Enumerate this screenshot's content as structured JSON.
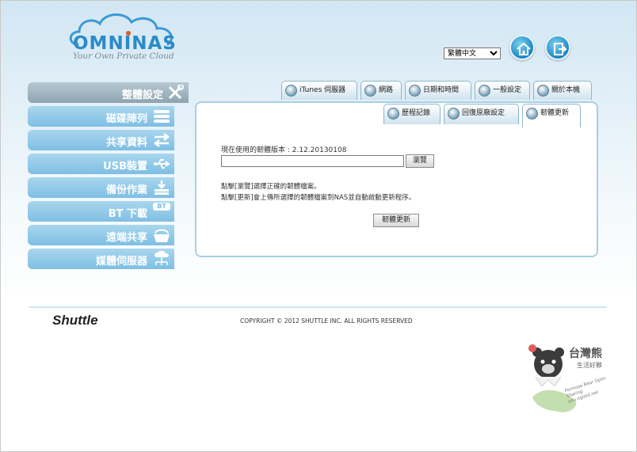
{
  "brand": {
    "name": "OMNINAS",
    "tagline": "Your Own Private Cloud"
  },
  "language": {
    "selected": "繁體中文"
  },
  "header_icons": {
    "home": "home-icon",
    "logout": "logout-icon"
  },
  "sidebar": {
    "items": [
      {
        "label": "整體設定",
        "icon": "tools-icon",
        "active": true
      },
      {
        "label": "磁碟陣列",
        "icon": "disk-stack-icon"
      },
      {
        "label": "共享資料",
        "icon": "share-arrows-icon"
      },
      {
        "label": "USB裝置",
        "icon": "usb-icon"
      },
      {
        "label": "備份作業",
        "icon": "backup-download-icon"
      },
      {
        "label": "BT 下載",
        "icon": "bt-download-icon",
        "badge": "BT"
      },
      {
        "label": "遠端共享",
        "icon": "remote-basket-icon"
      },
      {
        "label": "媒體伺服器",
        "icon": "media-server-icon"
      }
    ]
  },
  "top_tabs": [
    {
      "label": "iTunes 伺服器",
      "icon": "music-note-icon"
    },
    {
      "label": "網路",
      "icon": "globe-icon"
    },
    {
      "label": "日期和時間",
      "icon": "clock-icon"
    },
    {
      "label": "一般設定",
      "icon": "gear-icon"
    },
    {
      "label": "關於本機",
      "icon": "info-icon"
    }
  ],
  "sub_tabs": [
    {
      "label": "歷程記錄",
      "icon": "log-icon"
    },
    {
      "label": "回復原廠設定",
      "icon": "power-icon"
    },
    {
      "label": "韌體更新",
      "icon": "refresh-icon",
      "active": true
    }
  ],
  "firmware": {
    "version_label": "現在使用的韌體版本 : 2.12.20130108",
    "browse_label": "瀏覽",
    "hint_line1": "點擊[瀏覽]選擇正確的韌體檔案。",
    "hint_line2": "點擊[更新]會上傳所選擇的韌體檔案到NAS並自動啟動更新程序。",
    "update_label": "韌體更新",
    "file_value": ""
  },
  "footer": {
    "company": "Shuttle",
    "copyright": "COPYRIGHT © 2012 SHUTTLE INC. ALL RIGHTS RESERVED"
  },
  "watermark": {
    "title": "台灣熊",
    "subtitle": "生活好夥",
    "tagline": "Formosa Bear Open Sharing  you.xgood.net"
  },
  "colors": {
    "accent": "#2a8bc8",
    "sidebar": "#8fc8e8",
    "sidebar_active": "#97aab6",
    "panel_border": "#a9cfe4"
  }
}
